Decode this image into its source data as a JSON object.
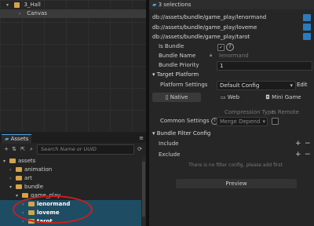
{
  "hierarchy": {
    "items": [
      {
        "label": "3_Hall",
        "arrow": "▾",
        "icon": "scene-icon"
      },
      {
        "label": "Canvas",
        "arrow": "›",
        "icon": "node-icon"
      }
    ]
  },
  "assets": {
    "tab_label": "Assets",
    "search_placeholder": "Search Name or UUID",
    "toolbar": {
      "add": "+",
      "sort": "⇅",
      "expand": "⇱",
      "search": "⌕",
      "menu": "≡"
    },
    "tree": [
      {
        "label": "assets",
        "arrow": "▾"
      },
      {
        "label": "animation",
        "arrow": "›"
      },
      {
        "label": "art",
        "arrow": "›"
      },
      {
        "label": "bundle",
        "arrow": "▾"
      },
      {
        "label": "game_play",
        "arrow": "▾"
      },
      {
        "label": "lenormand",
        "arrow": "›"
      },
      {
        "label": "loveme",
        "arrow": "›"
      },
      {
        "label": "tarot",
        "arrow": "›"
      }
    ]
  },
  "inspector": {
    "header": "3 selections",
    "paths": [
      "db://assets/bundle/game_play/lenormand",
      "db://assets/bundle/game_play/loveme",
      "db://assets/bundle/game_play/tarot"
    ],
    "is_bundle_label": "Is Bundle",
    "is_bundle_checked": "✓",
    "help_icon": "?",
    "bundle_name_label": "Bundle Name",
    "bundle_name_value": "lenormand",
    "bundle_priority_label": "Bundle Priority",
    "bundle_priority_value": "1",
    "target_platform_label": "Target Platform",
    "platform_settings_label": "Platform Settings",
    "platform_settings_value": "Default Config",
    "edit_label": "Edit",
    "tabs": [
      "Native",
      "Web",
      "Mini Game"
    ],
    "compression_type_label": "Compression Type",
    "is_remote_label": "Is Remote",
    "common_settings_label": "Common Settings",
    "merge_depend_value": "Merge Depend",
    "bundle_filter_label": "Bundle Filter Config",
    "include_label": "Include",
    "exclude_label": "Exclude",
    "no_filter_text": "There is no filter config, please add first",
    "preview_label": "Preview"
  },
  "colors": {
    "accent": "#2a7bbf",
    "highlight": "#1e4d63",
    "annotation": "#d01c1c",
    "folder": "#d6a34a"
  }
}
